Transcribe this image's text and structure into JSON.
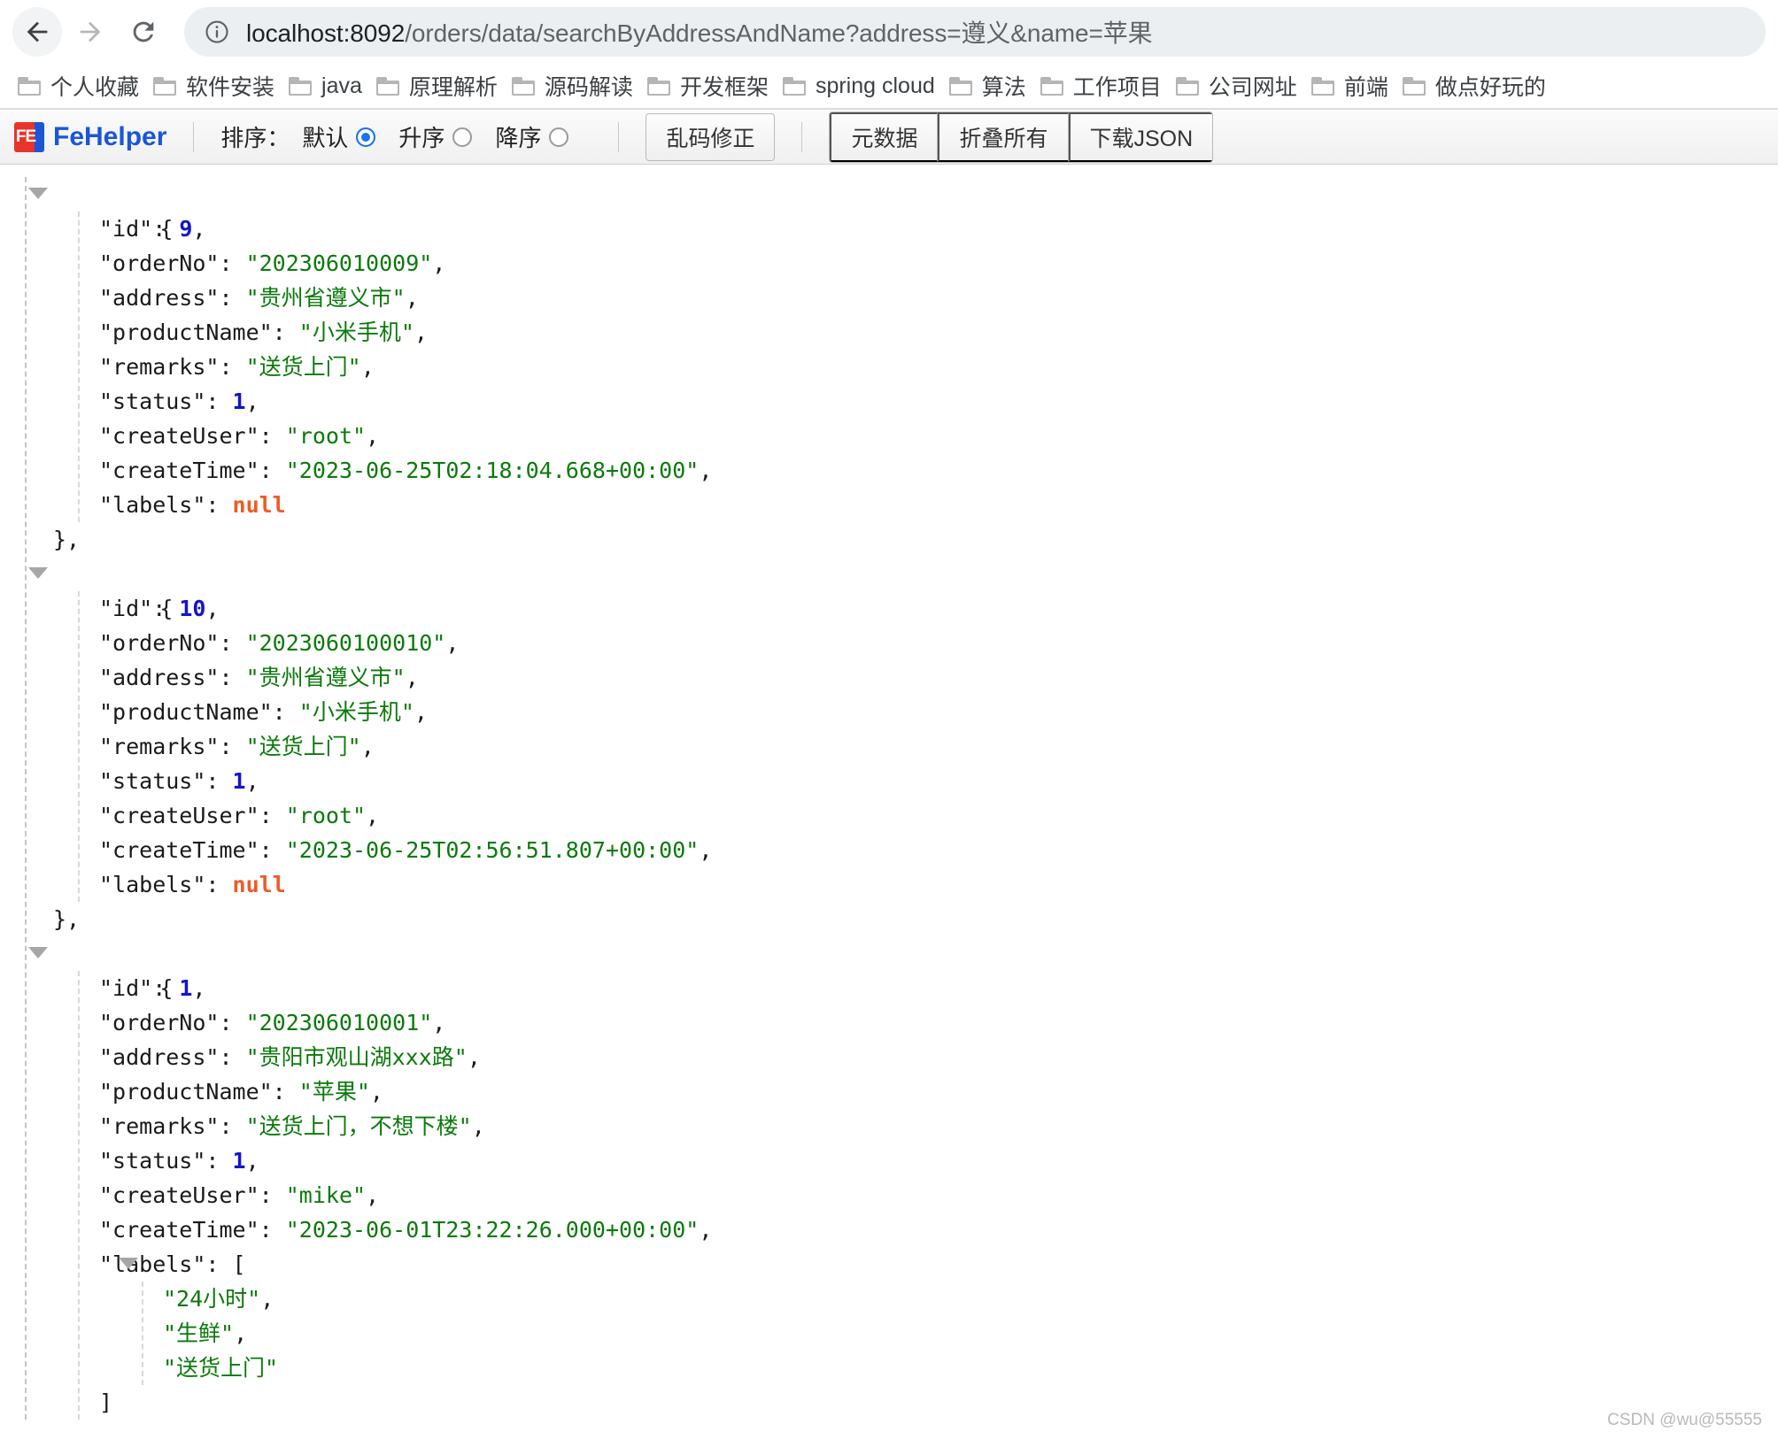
{
  "browser": {
    "back_label": "Back",
    "forward_label": "Forward",
    "reload_label": "Reload",
    "site_info_label": "Site information",
    "url_host": "localhost:8092",
    "url_path": "/orders/data/searchByAddressAndName?address=遵义&name=苹果"
  },
  "bookmarks": [
    {
      "label": "个人收藏"
    },
    {
      "label": "软件安装"
    },
    {
      "label": "java"
    },
    {
      "label": "原理解析"
    },
    {
      "label": "源码解读"
    },
    {
      "label": "开发框架"
    },
    {
      "label": "spring cloud"
    },
    {
      "label": "算法"
    },
    {
      "label": "工作项目"
    },
    {
      "label": "公司网址"
    },
    {
      "label": "前端"
    },
    {
      "label": "做点好玩的"
    }
  ],
  "fehelper": {
    "brand": "FeHelper",
    "logo_text": "FE",
    "sort_label": "排序：",
    "sort_options": [
      {
        "label": "默认",
        "checked": true
      },
      {
        "label": "升序",
        "checked": false
      },
      {
        "label": "降序",
        "checked": false
      }
    ],
    "fix_encoding_button": "乱码修正",
    "meta_button": "元数据",
    "collapse_all_button": "折叠所有",
    "download_json_button": "下载JSON"
  },
  "json": {
    "brace_open": "{",
    "brace_close_comma": "},",
    "bracket_open": "[",
    "bracket_close": "]",
    "comma": ",",
    "colon": ": ",
    "records": [
      {
        "id_key": "\"id\"",
        "id_value": "9",
        "orderNo_key": "\"orderNo\"",
        "orderNo_value": "\"202306010009\"",
        "address_key": "\"address\"",
        "address_value": "\"贵州省遵义市\"",
        "productName_key": "\"productName\"",
        "productName_value": "\"小米手机\"",
        "remarks_key": "\"remarks\"",
        "remarks_value": "\"送货上门\"",
        "status_key": "\"status\"",
        "status_value": "1",
        "createUser_key": "\"createUser\"",
        "createUser_value": "\"root\"",
        "createTime_key": "\"createTime\"",
        "createTime_value": "\"2023-06-25T02:18:04.668+00:00\"",
        "labels_key": "\"labels\"",
        "labels_value": "null"
      },
      {
        "id_key": "\"id\"",
        "id_value": "10",
        "orderNo_key": "\"orderNo\"",
        "orderNo_value": "\"2023060100010\"",
        "address_key": "\"address\"",
        "address_value": "\"贵州省遵义市\"",
        "productName_key": "\"productName\"",
        "productName_value": "\"小米手机\"",
        "remarks_key": "\"remarks\"",
        "remarks_value": "\"送货上门\"",
        "status_key": "\"status\"",
        "status_value": "1",
        "createUser_key": "\"createUser\"",
        "createUser_value": "\"root\"",
        "createTime_key": "\"createTime\"",
        "createTime_value": "\"2023-06-25T02:56:51.807+00:00\"",
        "labels_key": "\"labels\"",
        "labels_value": "null"
      },
      {
        "id_key": "\"id\"",
        "id_value": "1",
        "orderNo_key": "\"orderNo\"",
        "orderNo_value": "\"202306010001\"",
        "address_key": "\"address\"",
        "address_value": "\"贵阳市观山湖xxx路\"",
        "productName_key": "\"productName\"",
        "productName_value": "\"苹果\"",
        "remarks_key": "\"remarks\"",
        "remarks_value": "\"送货上门，不想下楼\"",
        "status_key": "\"status\"",
        "status_value": "1",
        "createUser_key": "\"createUser\"",
        "createUser_value": "\"mike\"",
        "createTime_key": "\"createTime\"",
        "createTime_value": "\"2023-06-01T23:22:26.000+00:00\"",
        "labels_key": "\"labels\"",
        "labels_items": [
          "\"24小时\"",
          "\"生鲜\"",
          "\"送货上门\""
        ]
      }
    ]
  },
  "watermark": "CSDN @wu@55555",
  "colors": {
    "string": "#0b7a0b",
    "number": "#1414cc",
    "null": "#ef5b26",
    "key": "#1a1a1a",
    "brand": "#1a56d6",
    "radio_checked": "#1a73e8"
  }
}
